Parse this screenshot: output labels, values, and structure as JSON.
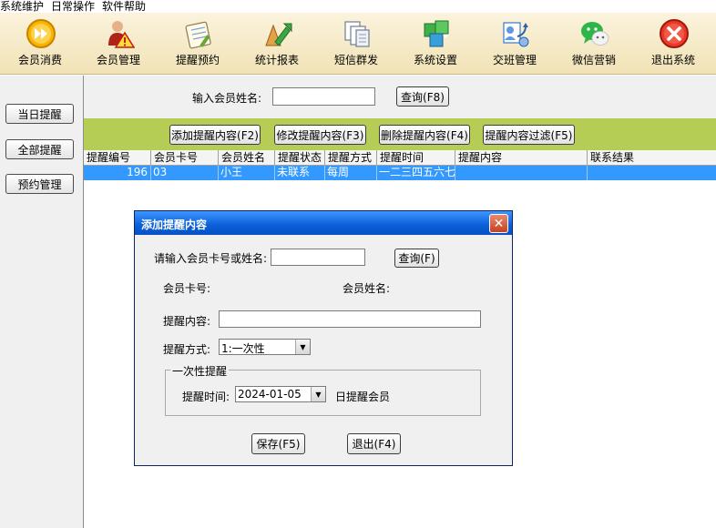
{
  "menu": {
    "items": [
      "系统维护",
      "日常操作",
      "软件帮助"
    ]
  },
  "toolbar": {
    "buttons": [
      {
        "label": "会员消费",
        "icon": "fast-forward-icon",
        "color": "#f5a000"
      },
      {
        "label": "会员管理",
        "icon": "member-warning-icon",
        "color": "#d8402a"
      },
      {
        "label": "提醒预约",
        "icon": "notepad-icon",
        "color": "#6aa832"
      },
      {
        "label": "统计报表",
        "icon": "chart-report-icon",
        "color": "#2e9b3a"
      },
      {
        "label": "短信群发",
        "icon": "documents-icon",
        "color": "#6d7e94"
      },
      {
        "label": "系统设置",
        "icon": "cubes-icon",
        "color": "#38a93c"
      },
      {
        "label": "交班管理",
        "icon": "handover-icon",
        "color": "#3a77c8"
      },
      {
        "label": "微信营销",
        "icon": "wechat-icon",
        "color": "#2db54a"
      },
      {
        "label": "退出系统",
        "icon": "exit-icon",
        "color": "#e03526"
      }
    ]
  },
  "sidebar": {
    "today": "当日提醒",
    "all": "全部提醒",
    "appointment": "预约管理"
  },
  "search": {
    "label": "输入会员姓名:",
    "value": "",
    "button": "查询(F8)"
  },
  "actions": {
    "add": "添加提醒内容(F2)",
    "edit": "修改提醒内容(F3)",
    "delete": "删除提醒内容(F4)",
    "filter": "提醒内容过滤(F5)"
  },
  "table": {
    "columns": [
      "提醒编号",
      "会员卡号",
      "会员姓名",
      "提醒状态",
      "提醒方式",
      "提醒时间",
      "提醒内容",
      "联系结果"
    ],
    "rows": [
      [
        "196",
        "03",
        "小王",
        "未联系",
        "每周",
        "一二三四五六七",
        "",
        ""
      ]
    ]
  },
  "dialog": {
    "title": "添加提醒内容",
    "search_label": "请输入会员卡号或姓名:",
    "search_value": "",
    "search_button": "查询(F)",
    "card_label": "会员卡号:",
    "name_label": "会员姓名:",
    "content_label": "提醒内容:",
    "content_value": "",
    "method_label": "提醒方式:",
    "method_value": "1:一次性",
    "group_title": "一次性提醒",
    "time_label": "提醒时间:",
    "time_value": "2024-01-05",
    "time_suffix": "日提醒会员",
    "save_button": "保存(F5)",
    "exit_button": "退出(F4)"
  },
  "colors": {
    "action_bar": "#b5cc55",
    "selected_row": "#3399ff",
    "title_bar": "#0a5fd8"
  }
}
